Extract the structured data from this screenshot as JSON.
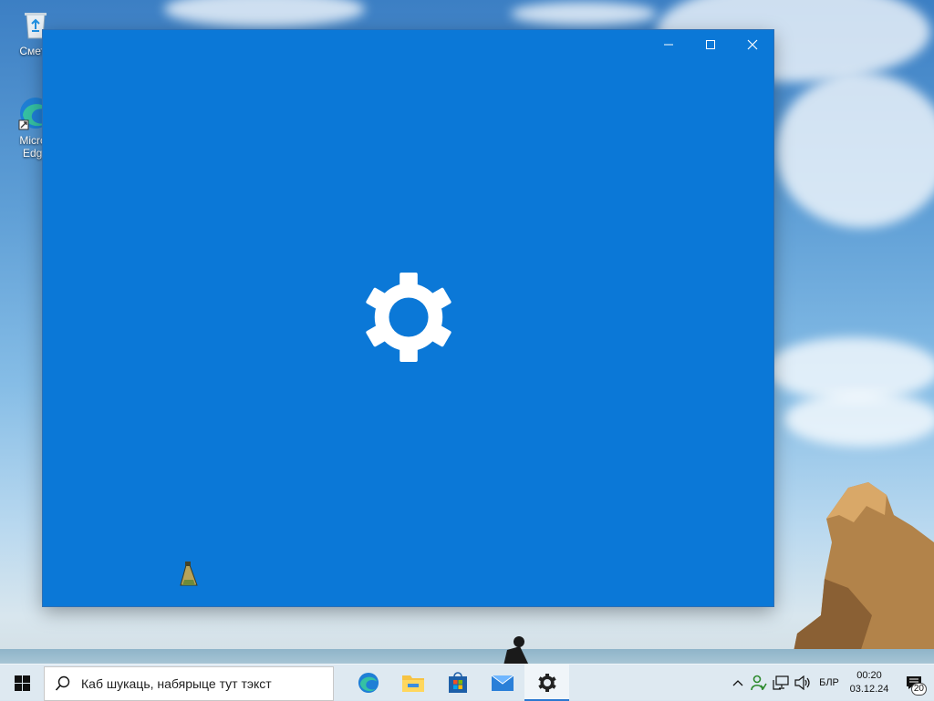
{
  "desktop": {
    "icons": [
      {
        "label": "Сметн",
        "icon": "recycle-bin-icon"
      },
      {
        "label": "Micros Edge",
        "line1": "Micros",
        "line2": "Edge",
        "icon": "edge-icon"
      }
    ]
  },
  "window": {
    "splash_icon": "gear-icon",
    "background_color": "#0b78d7",
    "controls": {
      "minimize": "minimize-icon",
      "maximize": "maximize-icon",
      "close": "close-icon"
    }
  },
  "taskbar": {
    "search_placeholder": "Каб шукаць, набярыце тут тэкст",
    "apps": [
      {
        "name": "Microsoft Edge",
        "icon": "edge-icon"
      },
      {
        "name": "File Explorer",
        "icon": "folder-icon"
      },
      {
        "name": "Microsoft Store",
        "icon": "store-icon"
      },
      {
        "name": "Mail",
        "icon": "mail-icon"
      },
      {
        "name": "Settings",
        "icon": "gear-icon",
        "active": true
      }
    ],
    "tray": {
      "language": "БЛР",
      "time": "00:20",
      "date": "03.12.24",
      "notification_count": "20"
    }
  }
}
